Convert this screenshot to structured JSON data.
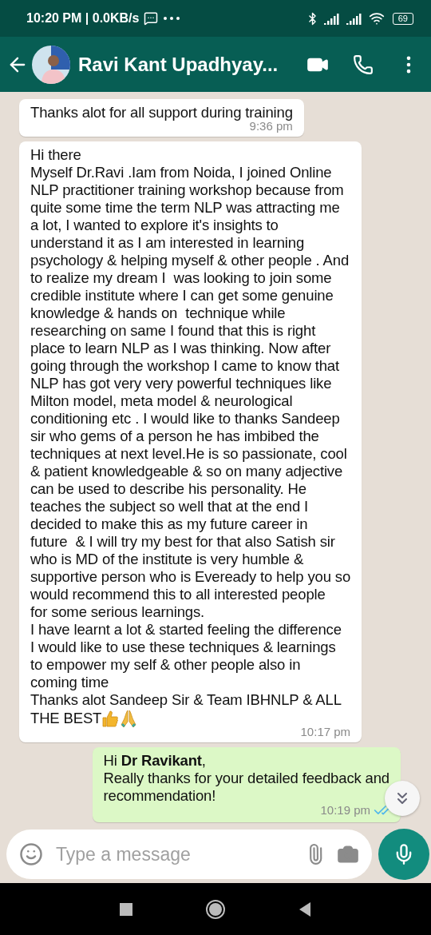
{
  "status_bar": {
    "time_speed": "10:20 PM | 0.0KB/s",
    "battery": "69"
  },
  "header": {
    "contact_name": "Ravi Kant Upadhyay..."
  },
  "messages": [
    {
      "kind": "received",
      "lines": [
        "Thanks alot for all support during training"
      ],
      "time": "9:36 pm"
    },
    {
      "kind": "received",
      "lines": [
        "Hi there",
        "Myself Dr.Ravi .Iam from Noida, I joined Online",
        "NLP practitioner training workshop because from",
        "quite some time the term NLP was attracting me",
        "a lot, I wanted to explore it's insights to",
        "understand it as I am interested in learning",
        "psychology & helping myself & other people . And",
        "to realize my dream I  was looking to join some",
        "credible institute where I can get some genuine",
        "knowledge & hands on  technique while",
        "researching on same I found that this is right",
        "place to learn NLP as I was thinking. Now after",
        "going through the workshop I came to know that",
        "NLP has got very very powerful techniques like",
        "Milton model, meta model & neurological",
        "conditioning etc . I would like to thanks Sandeep",
        "sir who gems of a person he has imbibed the",
        "techniques at next level.He is so passionate, cool",
        "& patient knowledgeable & so on many adjective",
        "can be used to describe his personality. He",
        "teaches the subject so well that at the end I",
        "decided to make this as my future career in",
        "future  & I will try my best for that also Satish sir",
        "who is MD of the institute is very humble &",
        "supportive person who is Eveready to help you so",
        "would recommend this to all interested people",
        "for some serious learnings.",
        "I have learnt a lot & started feeling the difference",
        "I would like to use these techniques & learnings",
        "to empower my self & other people also in",
        "coming time",
        "Thanks alot Sandeep Sir & Team IBHNLP & ALL",
        "THE BEST"
      ],
      "reactions": [
        {
          "kind": "thumbs_up"
        },
        {
          "kind": "pray"
        }
      ],
      "time": "10:17 pm"
    },
    {
      "kind": "sent",
      "lines": [
        "Hi **Dr Ravikant**,",
        "Really thanks for your detailed feedback and",
        "recommendation!"
      ],
      "time": "10:19 pm",
      "read": true
    }
  ],
  "composer": {
    "placeholder": "Type a message"
  }
}
